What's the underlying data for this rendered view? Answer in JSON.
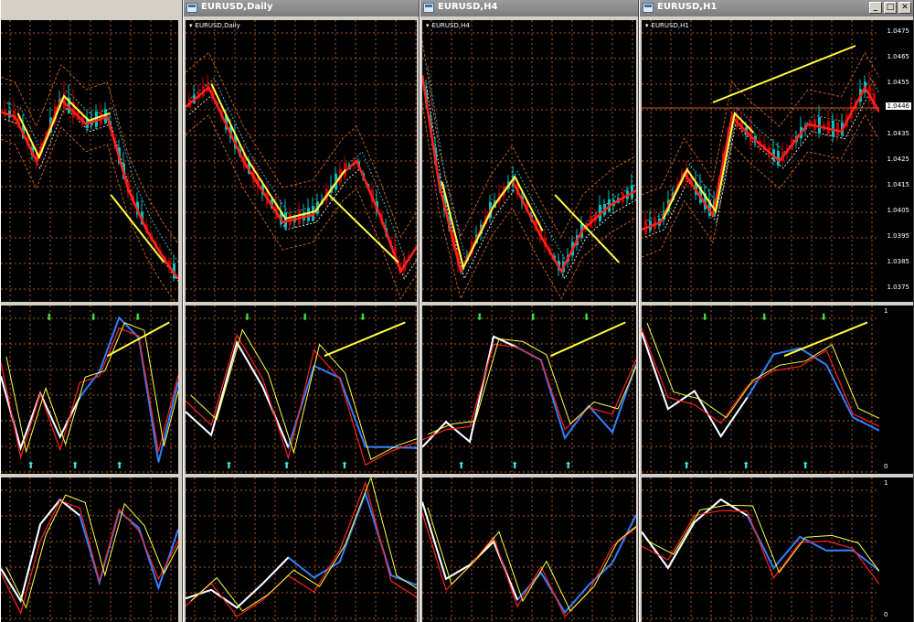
{
  "windows": [
    {
      "title": "",
      "buttons": [],
      "has_label": false
    },
    {
      "title": "EURUSD,Daily",
      "label": "EURUSD,Daily",
      "buttons": [],
      "has_label": true
    },
    {
      "title": "EURUSD,H4",
      "label": "EURUSD,H4",
      "buttons": [],
      "has_label": true
    },
    {
      "title": "EURUSD,H1",
      "label": "EURUSD,H1",
      "buttons": [
        "_",
        "□",
        "✕"
      ],
      "has_label": true
    }
  ],
  "price_scale": {
    "ticks": [
      "1.0475",
      "1.0465",
      "1.0455",
      "1.0446",
      "1.0435",
      "1.0425",
      "1.0415",
      "1.0405",
      "1.0395",
      "1.0385",
      "1.0375"
    ],
    "current_price": "1.0446"
  },
  "oscillator_scale": {
    "top": "1",
    "bottom": "0"
  },
  "colors": {
    "bullish": "#00c0c0",
    "bearish": "#c00000",
    "fast_ma": "#ff2020",
    "signal": "#ffff40",
    "grid": "#c06020",
    "line_white": "#ffffff",
    "line_blue": "#3080ff"
  },
  "icons": [
    "window-icon",
    "arrow-down-marker-icon",
    "arrow-up-marker-icon",
    "cross-marker-icon"
  ]
}
